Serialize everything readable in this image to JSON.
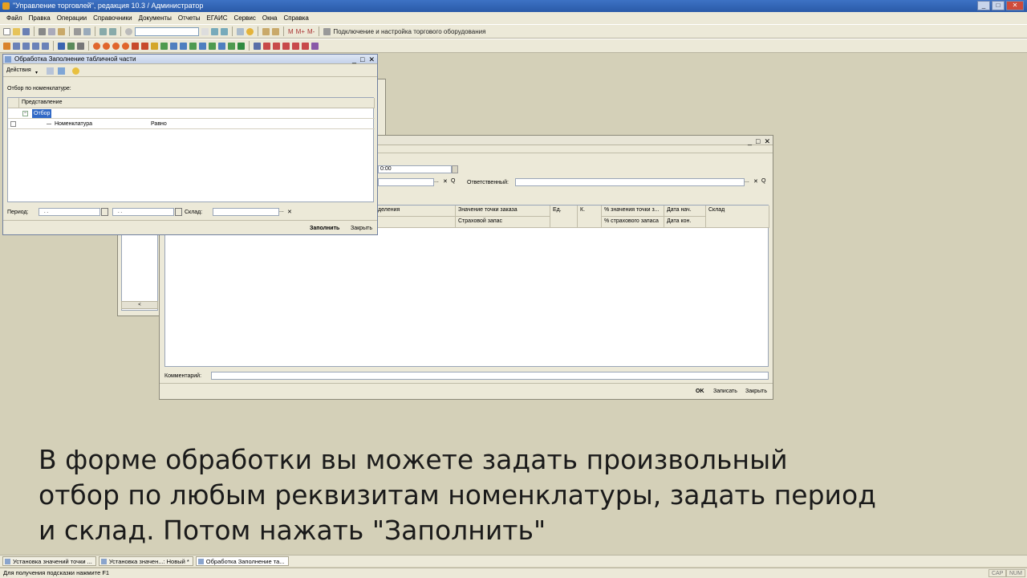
{
  "app": {
    "title": "\"Управление торговлей\", редакция 10.3 / Администратор",
    "window_buttons": [
      "_",
      "□",
      "✕"
    ]
  },
  "menu": [
    "Файл",
    "Правка",
    "Операции",
    "Справочники",
    "Документы",
    "Отчеты",
    "ЕГАИС",
    "Сервис",
    "Окна",
    "Справка"
  ],
  "toolbar": {
    "label_m": "M",
    "label_mplus": "M+",
    "label_mminus": "M-",
    "equipment_label": "Подключение и настройка торгового оборудования"
  },
  "fill_window": {
    "title": "Обработка  Заполнение табличной части",
    "actions_label": "Действия",
    "filter_title": "Отбор по номенклатуре:",
    "col_header": "Представление",
    "row_group": "Отбор",
    "row_item": "Номенклатура",
    "row_item_cond": "Равно",
    "period_label": "Период:",
    "period_from": ". .",
    "period_to": ". .",
    "warehouse_label": "Склад:",
    "fill_button": "Заполнить",
    "close_button": "Закрыть",
    "ellipsis": "...",
    "clear": "✕"
  },
  "doc_window": {
    "date_value": "0:00",
    "responsible_label": "Ответственный:",
    "ellipsis": "...",
    "clear": "✕",
    "search": "Q",
    "columns_top": [
      "деления",
      "Значение точки заказа",
      "Ед.",
      "К.",
      "% значения точки з...",
      "Дата нач.",
      "Склад"
    ],
    "columns_bottom": [
      "Страховой запас",
      "% страхового запаса",
      "Дата кон."
    ],
    "comment_label": "Комментарий:",
    "ok_button": "OK",
    "save_button": "Записать",
    "close_button": "Закрыть"
  },
  "back_window": {
    "scroll_left": "<"
  },
  "caption": {
    "line1": "В форме обработки вы можете задать произвольный",
    "line2": "отбор по любым реквизитам номенклатуры, задать период",
    "line3": "и склад. Потом нажать \"Заполнить\""
  },
  "taskbar": [
    "Установка значений точки ...",
    "Установка значен...: Новый *",
    "Обработка  Заполнение та..."
  ],
  "status": {
    "hint": "Для получения подсказки нажмите F1",
    "cap": "CAP",
    "num": "NUM"
  },
  "colors": {
    "desktop": "#d4d0b8",
    "titlebar": "#2a5aa8",
    "selected": "#3169c6"
  }
}
